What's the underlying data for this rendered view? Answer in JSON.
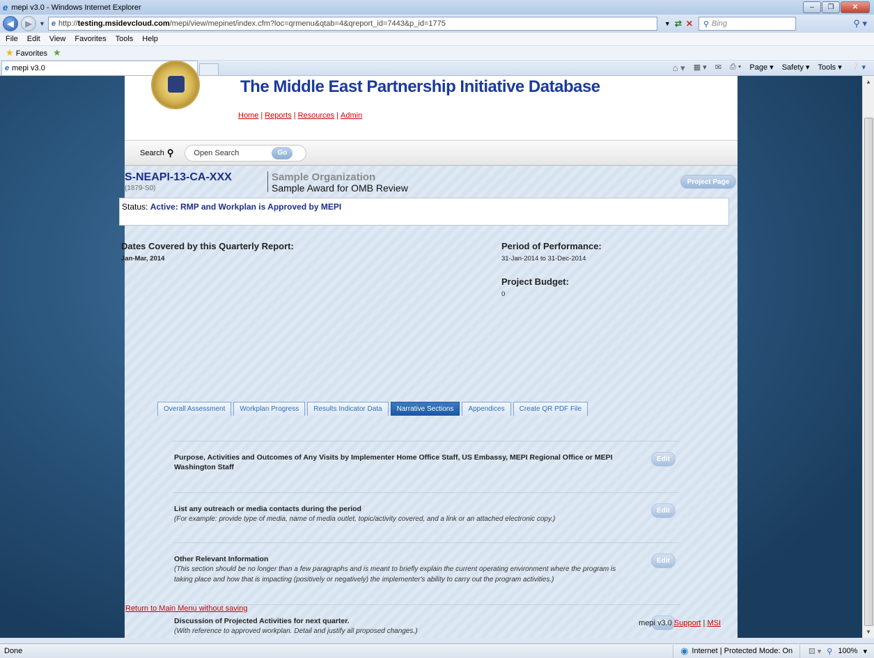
{
  "window": {
    "title": "mepi v3.0 - Windows Internet Explorer",
    "url_prefix": "http://",
    "url_host": "testing.msidevcloud.com",
    "url_path": "/mepi/view/mepinet/index.cfm?loc=qrmenu&qtab=4&qreport_id=7443&p_id=1775",
    "search_placeholder": "Bing"
  },
  "menubar": [
    "File",
    "Edit",
    "View",
    "Favorites",
    "Tools",
    "Help"
  ],
  "favorites_label": "Favorites",
  "tab_title": "mepi v3.0",
  "command_bar": [
    "Page ▾",
    "Safety ▾",
    "Tools ▾"
  ],
  "site": {
    "title": "The Middle East Partnership Initiative Database",
    "nav": [
      "Home",
      "Reports",
      "Resources",
      "Admin"
    ]
  },
  "search": {
    "label": "Search",
    "placeholder": "Open Search",
    "go_label": "Go"
  },
  "award": {
    "id": "S-NEAPI-13-CA-XXX",
    "sub_id": "(1879-S0)",
    "organization": "Sample Organization",
    "name": "Sample Award for OMB Review",
    "project_page_label": "Project Page"
  },
  "status": {
    "label": "Status:",
    "value": "Active: RMP and Workplan is Approved by MEPI"
  },
  "report": {
    "dates_label": "Dates Covered by this Quarterly Report:",
    "dates_value": "Jan-Mar, 2014",
    "period_label": "Period of Performance:",
    "period_value": "31-Jan-2014  to  31-Dec-2014",
    "budget_label": "Project Budget:",
    "budget_value": "0"
  },
  "tabs": [
    {
      "label": "Overall Assessment",
      "active": false
    },
    {
      "label": "Workplan Progress",
      "active": false
    },
    {
      "label": "Results Indicator Data",
      "active": false
    },
    {
      "label": "Narrative Sections",
      "active": true
    },
    {
      "label": "Appendices",
      "active": false
    },
    {
      "label": "Create QR PDF File",
      "active": false
    }
  ],
  "sections": [
    {
      "title": "Purpose, Activities and Outcomes of Any Visits by Implementer Home Office Staff, US Embassy, MEPI Regional Office or MEPI Washington Staff",
      "desc": "",
      "edit_label": "Edit"
    },
    {
      "title": "List any outreach or media contacts during the period",
      "desc": "(For example: provide type of media, name of media outlet, topic/activity covered, and a link or an attached electronic copy.)",
      "edit_label": "Edit"
    },
    {
      "title": "Other Relevant Information",
      "desc": "(This section should be no longer than a few paragraphs and is meant to briefly explain the current operating environment where the program is taking place and how that is impacting (positively or negatively) the implementer's ability to carry out the program activities.)",
      "edit_label": "Edit"
    },
    {
      "title": "Discussion of Projected Activities for next quarter.",
      "desc": "(With reference to approved workplan. Detail and justify all proposed changes.)",
      "edit_label": "Edit"
    }
  ],
  "return_link": "Return to Main Menu without saving",
  "footer": {
    "version": "mepi v3.0",
    "support": "Support",
    "sep": "|",
    "msi": "MSI"
  },
  "statusbar": {
    "left": "Done",
    "zone": "Internet | Protected Mode: On",
    "zoom": "100%"
  }
}
